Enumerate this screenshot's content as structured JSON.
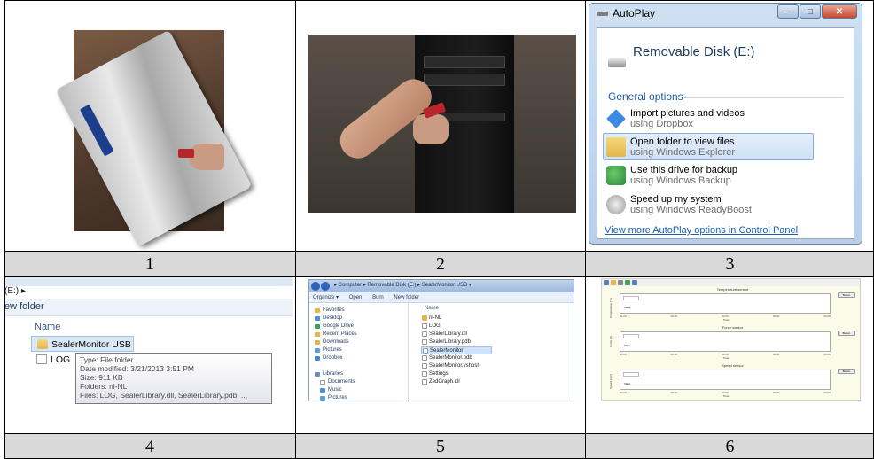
{
  "captions": [
    "1",
    "2",
    "3",
    "4",
    "5",
    "6"
  ],
  "autoplay": {
    "window_title": "AutoPlay",
    "drive_name": "Removable Disk (E:)",
    "section_label": "General options",
    "options": [
      {
        "title": "Import pictures and videos",
        "subtitle": "using Dropbox",
        "icon": "dropbox-icon",
        "selected": false
      },
      {
        "title": "Open folder to view files",
        "subtitle": "using Windows Explorer",
        "icon": "folder-icon",
        "selected": true
      },
      {
        "title": "Use this drive for backup",
        "subtitle": "using Windows Backup",
        "icon": "backup-icon",
        "selected": false
      },
      {
        "title": "Speed up my system",
        "subtitle": "using Windows ReadyBoost",
        "icon": "readyboost-icon",
        "selected": false
      }
    ],
    "control_panel_link": "View more AutoPlay options in Control Panel"
  },
  "explorer_zoom": {
    "address": "(E:) ▸",
    "new_folder": "ew folder",
    "column_name": "Name",
    "rows": [
      {
        "name": "SealerMonitor USB",
        "icon": "folder-icon",
        "selected": true
      },
      {
        "name": "LOG",
        "icon": "file-icon",
        "selected": false
      }
    ],
    "tooltip": [
      "Type: File folder",
      "Date modified: 3/21/2013 3:51 PM",
      "Size: 911 KB",
      "Folders: nl-NL",
      "Files: LOG, SealerLibrary.dll, SealerLibrary.pdb, ..."
    ]
  },
  "explorer_window": {
    "path": "▸ Computer ▸ Removable Disk (E:) ▸ SealerMonitor USB ▾",
    "commands": [
      "Organize ▾",
      "Open",
      "Burn",
      "New folder"
    ],
    "favorites_label": "Favorites",
    "nav_items": [
      "Desktop",
      "Google Drive",
      "Recent Places",
      "Downloads",
      "Pictures",
      "Dropbox"
    ],
    "libraries_label": "Libraries",
    "library_items": [
      "Documents",
      "Music",
      "Pictures"
    ],
    "column_name": "Name",
    "files": [
      {
        "name": "nl-NL",
        "type": "folder",
        "selected": false
      },
      {
        "name": "LOG",
        "type": "file",
        "selected": false
      },
      {
        "name": "SealerLibrary.dll",
        "type": "file",
        "selected": false
      },
      {
        "name": "SealerLibrary.pdb",
        "type": "file",
        "selected": false
      },
      {
        "name": "SealerMonitor",
        "type": "file",
        "selected": true
      },
      {
        "name": "SealerMonitor.pdb",
        "type": "file",
        "selected": false
      },
      {
        "name": "SealerMonitor.vshost",
        "type": "file",
        "selected": false
      },
      {
        "name": "Settings",
        "type": "file",
        "selected": false
      },
      {
        "name": "ZedGraph.dll",
        "type": "file",
        "selected": false
      }
    ]
  },
  "sensor_monitor": {
    "charts": [
      {
        "title": "Temperature sensor",
        "ylabel": "Temperature (°C)",
        "xlabel": "Time"
      },
      {
        "title": "Force sensor",
        "ylabel": "Force (N)",
        "xlabel": "Time"
      },
      {
        "title": "Speed sensor",
        "ylabel": "Speed (rpm)",
        "xlabel": "Time"
      }
    ],
    "tick_labels": [
      "00:00",
      "00:00",
      "00:00",
      "00:00",
      "00:00"
    ],
    "legend_label": "Value",
    "button_label": "Button"
  },
  "colors": {
    "caption_bg": "#d9d9d9",
    "link": "#1a5fb4",
    "selection": "#cfe1f7"
  }
}
